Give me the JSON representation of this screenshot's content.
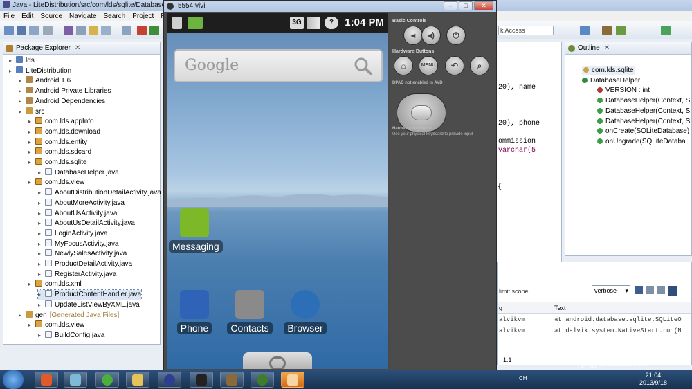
{
  "eclipse": {
    "title": "Java - LiteDistribution/src/com/lds/sqlite/DatabaseH",
    "menu": [
      "File",
      "Edit",
      "Source",
      "Navigate",
      "Search",
      "Project",
      "Re"
    ],
    "quick_access": "k Access"
  },
  "package_explorer": {
    "title": "Package Explorer",
    "rows": [
      {
        "label": "lds",
        "indent": 0
      },
      {
        "label": "LiteDistribution",
        "indent": 0
      },
      {
        "label": "Android 1.6",
        "indent": 1
      },
      {
        "label": "Android Private Libraries",
        "indent": 1
      },
      {
        "label": "Android Dependencies",
        "indent": 1
      },
      {
        "label": "src",
        "indent": 1
      },
      {
        "label": "com.lds.appInfo",
        "indent": 2
      },
      {
        "label": "com.lds.download",
        "indent": 2
      },
      {
        "label": "com.lds.entity",
        "indent": 2
      },
      {
        "label": "com.lds.sdcard",
        "indent": 2
      },
      {
        "label": "com.lds.sqlite",
        "indent": 2
      },
      {
        "label": "DatabaseHelper.java",
        "indent": 3
      },
      {
        "label": "com.lds.view",
        "indent": 2
      },
      {
        "label": "AboutDistributionDetailActivity.java",
        "indent": 3
      },
      {
        "label": "AboutMoreActivity.java",
        "indent": 3
      },
      {
        "label": "AboutUsActivity.java",
        "indent": 3
      },
      {
        "label": "AboutUsDetailActivity.java",
        "indent": 3
      },
      {
        "label": "LoginActivity.java",
        "indent": 3
      },
      {
        "label": "MyFocusActivity.java",
        "indent": 3
      },
      {
        "label": "NewlySalesActivity.java",
        "indent": 3
      },
      {
        "label": "ProductDetailActivity.java",
        "indent": 3
      },
      {
        "label": "RegisterActivity.java",
        "indent": 3
      },
      {
        "label": "com.lds.xml",
        "indent": 2
      },
      {
        "label": "ProductContentHandler.java",
        "indent": 3
      },
      {
        "label": "UpdateListViewByXML.java",
        "indent": 3
      },
      {
        "label": "gen",
        "indent": 1,
        "suffix": "[Generated Java Files]"
      },
      {
        "label": "com.lds.view",
        "indent": 2
      },
      {
        "label": "BuildConfig.java",
        "indent": 3
      }
    ]
  },
  "editor": {
    "lines": [
      "20), name",
      "20), phone",
      "ommission",
      " varchar(5",
      ") {"
    ]
  },
  "outline": {
    "title": "Outline",
    "rows": [
      {
        "label": "com.lds.sqlite",
        "indent": 0
      },
      {
        "label": "DatabaseHelper",
        "indent": 0
      },
      {
        "label": "VERSION : int",
        "indent": 1
      },
      {
        "label": "DatabaseHelper(Context, S",
        "indent": 1
      },
      {
        "label": "DatabaseHelper(Context, S",
        "indent": 1
      },
      {
        "label": "DatabaseHelper(Context, S",
        "indent": 1
      },
      {
        "label": "onCreate(SQLiteDatabase)",
        "indent": 1
      },
      {
        "label": "onUpgrade(SQLiteDataba",
        "indent": 1
      }
    ]
  },
  "logcat": {
    "filter_placeholder": "limit scope.",
    "level": "verbose",
    "col_tag": "g",
    "col_text": "Text",
    "rows": [
      {
        "tag": "alvikvm",
        "text": "at android.database.sqlite.SQLiteO"
      },
      {
        "tag": "alvikvm",
        "text": "at dalvik.system.NativeStart.run(N"
      }
    ],
    "position": "1:1"
  },
  "emulator": {
    "title": "5554:vivi",
    "clock": "1:04 PM",
    "network": "3G",
    "search_logo": "Google",
    "apps": [
      {
        "label": "Messaging",
        "color": "#7cb828"
      },
      {
        "label": "Phone",
        "color": "#2f63b8"
      },
      {
        "label": "Contacts",
        "color": "#8a8a8a"
      },
      {
        "label": "Browser",
        "color": "#2d6fb6"
      }
    ],
    "controls": {
      "basic_title": "Basic Controls",
      "hardware_title": "Hardware Buttons",
      "menu_label": "MENU",
      "dpad_title": "DPAD not enabled in AVD",
      "keyboard_title": "Hardware Keyboard",
      "keyboard_sub": "Use your physical keyboard to provide input"
    }
  },
  "taskbar": {
    "time": "21:04",
    "date": "2013/9/18",
    "lang": "CH"
  },
  "watermark": {
    "text": "Bai",
    "sub": "jingyan.baidu.com"
  }
}
